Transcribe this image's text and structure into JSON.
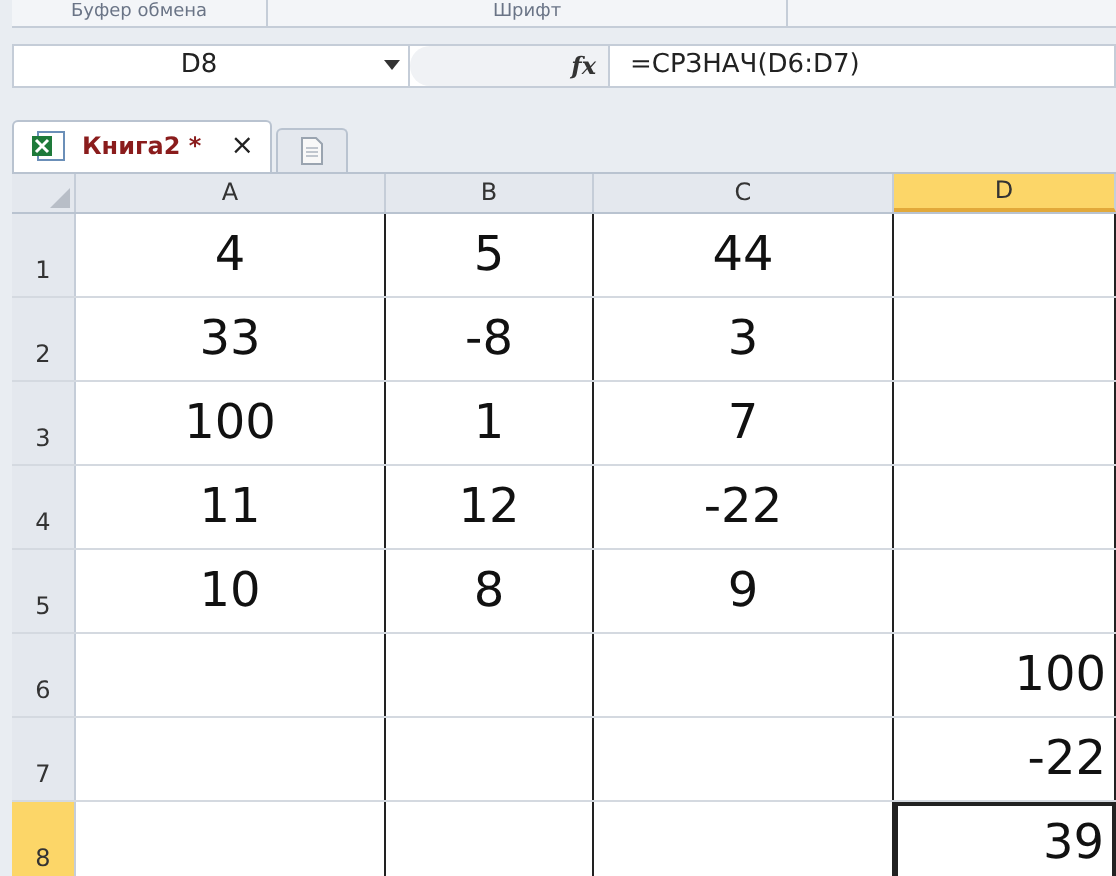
{
  "ribbon_groups": [
    {
      "label": "Буфер обмена"
    },
    {
      "label": "Шрифт"
    }
  ],
  "formula_bar": {
    "name_box": "D8",
    "fx": "fx",
    "formula": "=СРЗНАЧ(D6:D7)"
  },
  "tabs": [
    {
      "label": "Книга2 *",
      "close": "×",
      "selected": true
    }
  ],
  "columns": [
    {
      "label": "A",
      "selected": false
    },
    {
      "label": "B",
      "selected": false
    },
    {
      "label": "C",
      "selected": false
    },
    {
      "label": "D",
      "selected": true
    }
  ],
  "rows": [
    {
      "number": "1",
      "selected": false,
      "cells": [
        {
          "value": "4",
          "selected": false
        },
        {
          "value": "5",
          "selected": false
        },
        {
          "value": "44",
          "selected": false
        },
        {
          "selected": false
        }
      ]
    },
    {
      "number": "2",
      "selected": false,
      "cells": [
        {
          "value": "33",
          "selected": false
        },
        {
          "value": "-8",
          "selected": false
        },
        {
          "value": "3",
          "selected": false
        },
        {
          "selected": false
        }
      ]
    },
    {
      "number": "3",
      "selected": false,
      "cells": [
        {
          "value": "100",
          "selected": false
        },
        {
          "value": "1",
          "selected": false
        },
        {
          "value": "7",
          "selected": false
        },
        {
          "selected": false
        }
      ]
    },
    {
      "number": "4",
      "selected": false,
      "cells": [
        {
          "value": "11",
          "selected": false
        },
        {
          "value": "12",
          "selected": false
        },
        {
          "value": "-22",
          "selected": false
        },
        {
          "selected": false
        }
      ]
    },
    {
      "number": "5",
      "selected": false,
      "cells": [
        {
          "value": "10",
          "selected": false
        },
        {
          "value": "8",
          "selected": false
        },
        {
          "value": "9",
          "selected": false
        },
        {
          "selected": false
        }
      ]
    },
    {
      "number": "6",
      "selected": false,
      "cells": [
        {
          "selected": false
        },
        {
          "selected": false
        },
        {
          "selected": false
        },
        {
          "value": "100",
          "selected": false
        }
      ]
    },
    {
      "number": "7",
      "selected": false,
      "cells": [
        {
          "selected": false
        },
        {
          "selected": false
        },
        {
          "selected": false
        },
        {
          "value": "-22",
          "selected": false
        }
      ]
    },
    {
      "number": "8",
      "selected": true,
      "cells": [
        {
          "selected": false
        },
        {
          "selected": false
        },
        {
          "selected": false
        },
        {
          "value": "39",
          "selected": true
        }
      ]
    }
  ]
}
